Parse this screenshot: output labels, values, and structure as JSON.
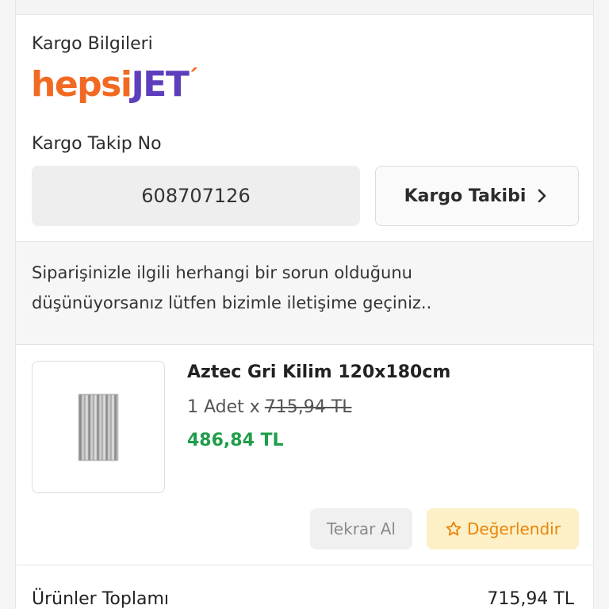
{
  "cargo": {
    "title": "Kargo Bilgileri",
    "carrier_logo": {
      "part1": "hepsi",
      "part2": "JET",
      "accent": "´"
    },
    "tracking_label": "Kargo Takip No",
    "tracking_number": "608707126",
    "track_button_label": "Kargo Takibi"
  },
  "notice": {
    "text": "Siparişinizle ilgili herhangi bir sorun olduğunu düşünüyorsanız lütfen bizimle iletişime geçiniz.."
  },
  "product": {
    "name": "Aztec Gri Kilim 120x180cm",
    "quantity_text": "1 Adet x",
    "original_price": "715,94 TL",
    "discounted_price": "486,84 TL",
    "reorder_label": "Tekrar Al",
    "rate_label": "Değerlendir",
    "rate_icon": "star-icon"
  },
  "totals": {
    "products_total_label": "Ürünler Toplamı",
    "products_total_value": "715,94 TL"
  },
  "colors": {
    "brand_orange": "#f26a22",
    "brand_purple": "#5d3ebc",
    "price_green": "#1f9d4a",
    "rate_accent": "#e8850c",
    "rate_bg": "#fdf0c7"
  }
}
